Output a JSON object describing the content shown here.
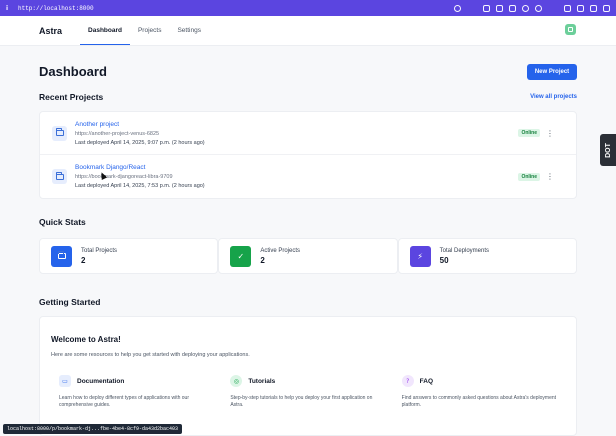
{
  "browser": {
    "url": "http://localhost:8000"
  },
  "header": {
    "brand": "Astra",
    "tabs": [
      {
        "label": "Dashboard",
        "active": true
      },
      {
        "label": "Projects"
      },
      {
        "label": "Settings"
      }
    ]
  },
  "main": {
    "title": "Dashboard",
    "new_project_label": "New Project",
    "recent_title": "Recent Projects",
    "view_all_label": "View all projects",
    "projects": [
      {
        "name": "Another project",
        "url": "https://another-project-venus-6825",
        "deployed": "Last deployed April 14, 2025, 9:07 p.m. (2 hours ago)",
        "status": "Online"
      },
      {
        "name": "Bookmark Django/React",
        "url": "https://bookmark-djangoreact-libra-9709",
        "deployed": "Last deployed April 14, 2025, 7:53 p.m. (2 hours ago)",
        "status": "Online"
      }
    ],
    "stats_title": "Quick Stats",
    "stats": [
      {
        "label": "Total Projects",
        "value": "2",
        "icon": "folder-icon",
        "color": "#2563eb"
      },
      {
        "label": "Active Projects",
        "value": "2",
        "icon": "check-circle-icon",
        "color": "#16a34a"
      },
      {
        "label": "Total Deployments",
        "value": "50",
        "icon": "bolt-icon",
        "color": "#5b45e0"
      }
    ],
    "getting_started_title": "Getting Started",
    "welcome_title": "Welcome to Astra!",
    "welcome_sub": "Here are some resources to help you get started with deploying your applications.",
    "resources": [
      {
        "title": "Documentation",
        "text": "Learn how to deploy different types of applications with our comprehensive guides.",
        "icon": "book-icon",
        "color": "#2563eb",
        "bg": "#e6edfd"
      },
      {
        "title": "Tutorials",
        "text": "Step-by-step tutorials to help you deploy your first application on Astra.",
        "icon": "globe-icon",
        "color": "#16a34a",
        "bg": "#dcf5e6"
      },
      {
        "title": "FAQ",
        "text": "Find answers to commonly asked questions about Astra's deployment platform.",
        "icon": "question-icon",
        "color": "#9333ea",
        "bg": "#f1e6fd"
      }
    ]
  },
  "dot_handle_label": "DOT",
  "status_url": "localhost:8000/p/bookmark-dj...fbe-4be4-8cf9-da43d2bac403"
}
